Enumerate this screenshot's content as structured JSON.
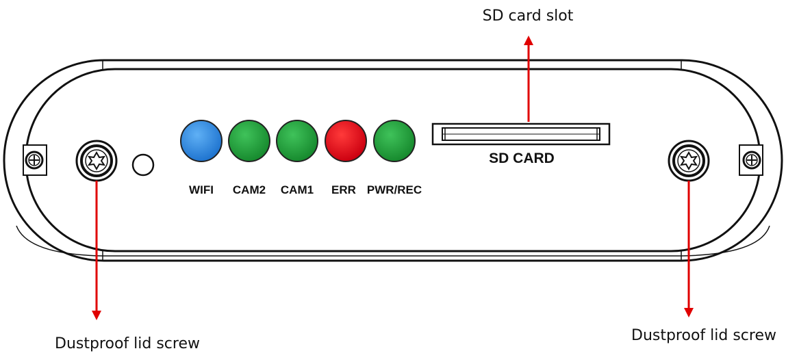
{
  "callouts": {
    "sd_slot": "SD card slot",
    "screw_left": "Dustproof lid screw",
    "screw_right": "Dustproof lid screw"
  },
  "panel": {
    "sd_label": "SD CARD",
    "leds": [
      {
        "label": "WIFI",
        "color": "#2b86e0"
      },
      {
        "label": "CAM2",
        "color": "#1fa33a"
      },
      {
        "label": "CAM1",
        "color": "#1fa33a"
      },
      {
        "label": "ERR",
        "color": "#e0101c"
      },
      {
        "label": "PWR/REC",
        "color": "#1fa33a"
      }
    ]
  },
  "colors": {
    "arrow": "#e00000",
    "outline": "#111111"
  }
}
